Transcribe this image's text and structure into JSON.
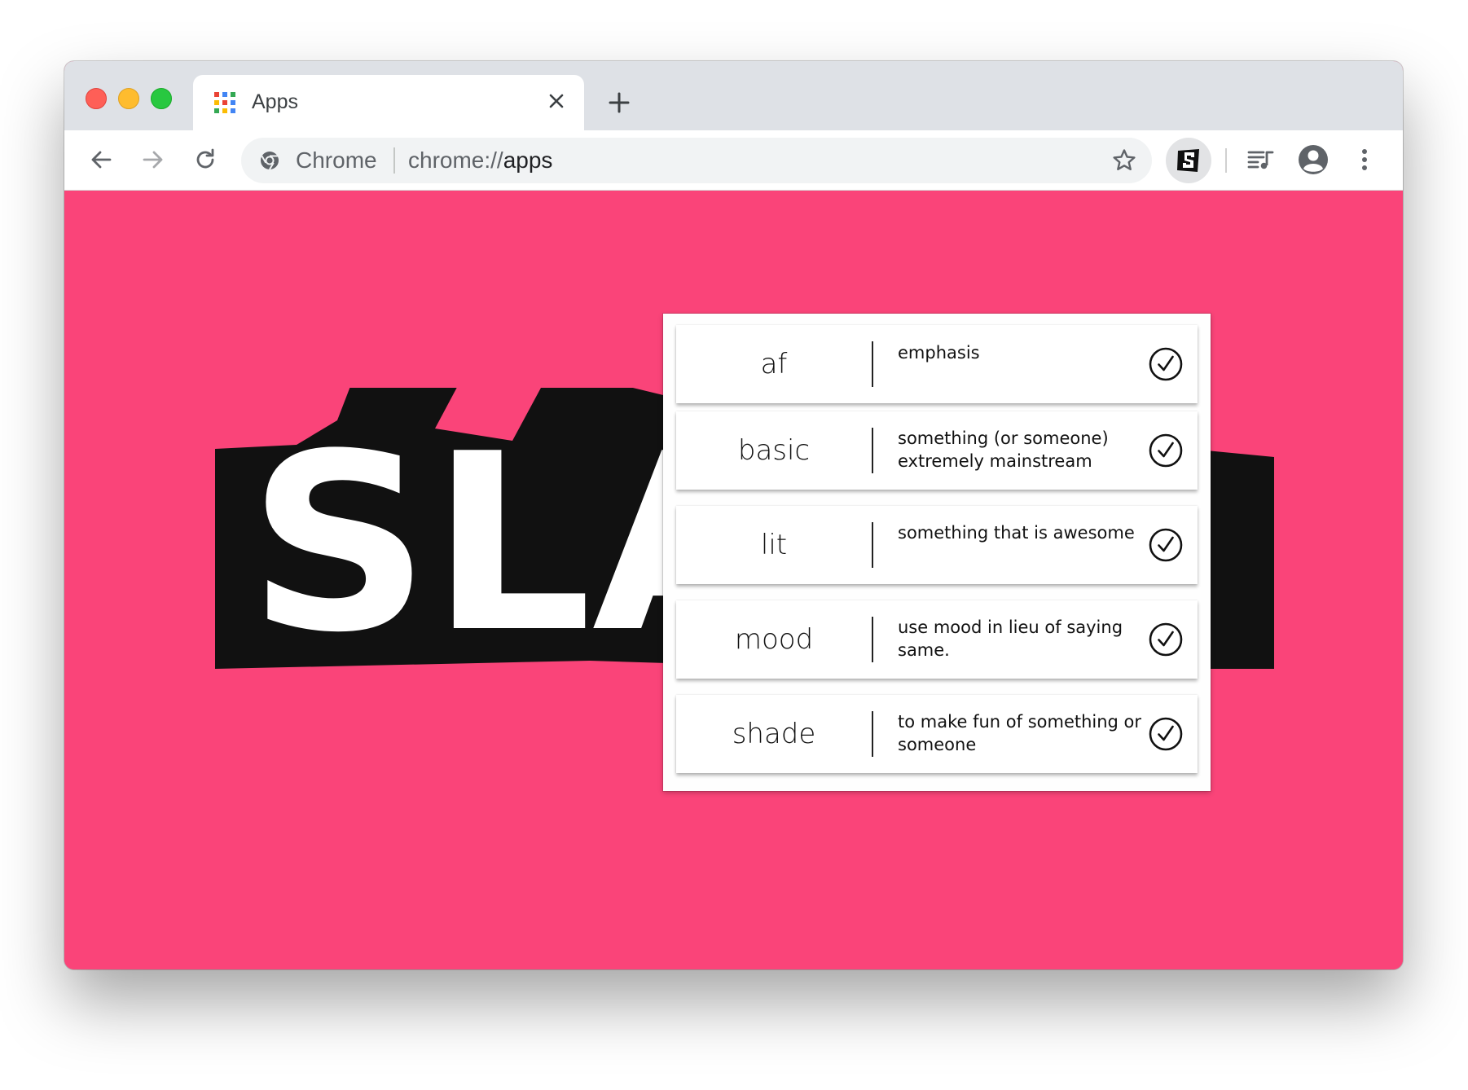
{
  "window": {
    "traffic_lights": [
      "close",
      "minimize",
      "zoom"
    ]
  },
  "tab": {
    "title": "Apps",
    "favicon": "apps-grid-icon",
    "favicon_colors": [
      "#ea4335",
      "#4285f4",
      "#34a853",
      "#fbbc04",
      "#ea4335",
      "#4285f4",
      "#34a853",
      "#fbbc04",
      "#4285f4"
    ]
  },
  "toolbar": {
    "back_icon": "arrow-left-icon",
    "forward_icon": "arrow-right-icon",
    "reload_icon": "reload-icon",
    "site_label": "Chrome",
    "url_scheme": "chrome://",
    "url_host": "apps",
    "bookmark_icon": "star-icon",
    "extension_icon": "slang-extension-icon",
    "media_icon": "queue-music-icon",
    "profile_icon": "account-circle-icon",
    "menu_icon": "more-vert-icon"
  },
  "page": {
    "background_color": "#fa4479",
    "logo_text": "SLANG"
  },
  "popup": {
    "entries": [
      {
        "word": "af",
        "definition": "emphasis",
        "checked": true
      },
      {
        "word": "basic",
        "definition": "something (or someone) extremely mainstream",
        "checked": true
      },
      {
        "word": "lit",
        "definition": "something that is awesome",
        "checked": true
      },
      {
        "word": "mood",
        "definition": "use mood in lieu of saying same.",
        "checked": true
      },
      {
        "word": "shade",
        "definition": "to make fun of something or someone",
        "checked": true
      }
    ]
  }
}
